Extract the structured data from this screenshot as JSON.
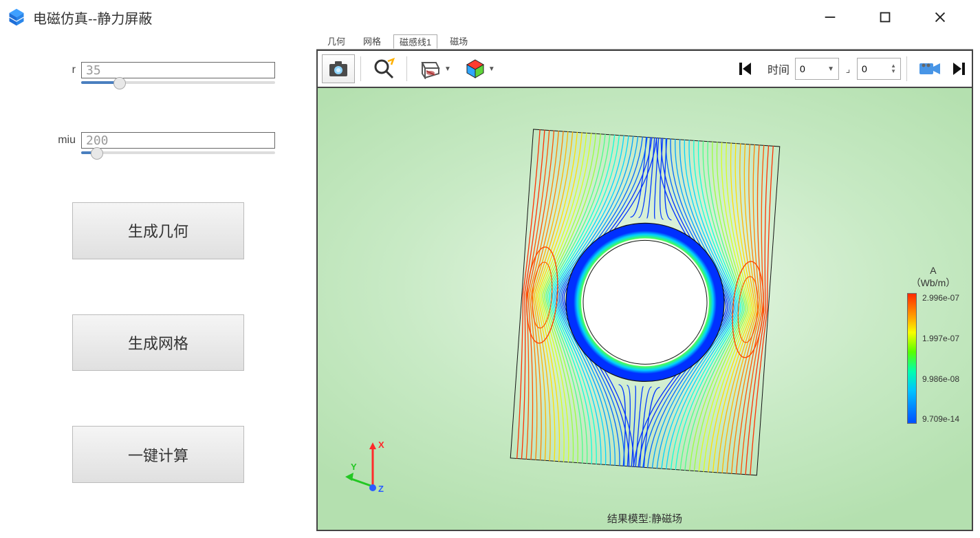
{
  "window": {
    "title": "电磁仿真--静力屏蔽"
  },
  "sidebar": {
    "params": {
      "r": {
        "label": "r",
        "value": "35",
        "slider_percent": 20
      },
      "miu": {
        "label": "miu",
        "value": "200",
        "slider_percent": 8
      }
    },
    "buttons": {
      "gen_geometry": "生成几何",
      "gen_mesh": "生成网格",
      "one_click": "一键计算"
    }
  },
  "tabs": {
    "items": [
      "几何",
      "网格",
      "磁感线1",
      "磁场"
    ],
    "active_index": 2
  },
  "viewer_toolbar": {
    "time_label": "时间",
    "time_value": "0",
    "frame_value": "0"
  },
  "canvas": {
    "footer": "结果模型:静磁场",
    "axes": {
      "x": "X",
      "y": "Y",
      "z": "Z"
    }
  },
  "legend": {
    "title_line1": "A",
    "title_line2": "（Wb/m）",
    "ticks": [
      "2.996e-07",
      "1.997e-07",
      "9.986e-08",
      "9.709e-14"
    ]
  }
}
